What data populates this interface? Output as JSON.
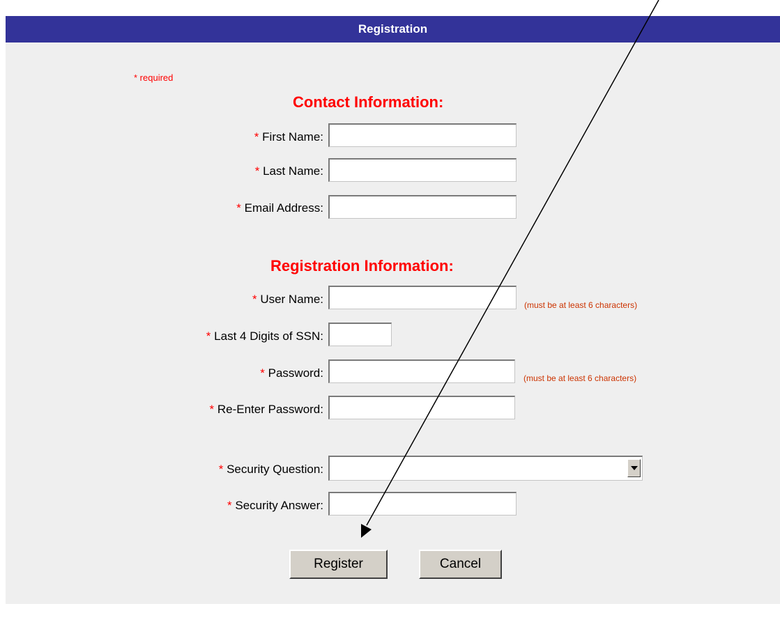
{
  "header": {
    "title": "Registration"
  },
  "required_note": "* required",
  "sections": {
    "contact": "Contact Information:",
    "registration": "Registration Information:"
  },
  "required_star": "*",
  "fields": {
    "first_name": {
      "label": "First Name:",
      "value": ""
    },
    "last_name": {
      "label": "Last Name:",
      "value": ""
    },
    "email": {
      "label": "Email Address:",
      "value": ""
    },
    "user_name": {
      "label": "User Name:",
      "value": "",
      "hint": "(must be at least 6 characters)"
    },
    "ssn_last4": {
      "label": "Last 4 Digits of SSN:",
      "value": ""
    },
    "password": {
      "label": "Password:",
      "value": "",
      "hint": "(must be at least 6 characters)"
    },
    "reenter_password": {
      "label": "Re-Enter Password:",
      "value": ""
    },
    "security_question": {
      "label": "Security Question:",
      "selected": ""
    },
    "security_answer": {
      "label": "Security Answer:",
      "value": ""
    }
  },
  "buttons": {
    "register": "Register",
    "cancel": "Cancel"
  },
  "icons": {
    "dropdown": "triangle-down-icon"
  },
  "colors": {
    "header_bg": "#333399",
    "header_text": "#ffffff",
    "panel_bg": "#efefef",
    "required": "#ff0000",
    "hint": "#cc3300",
    "button_face": "#d4d0c8"
  }
}
